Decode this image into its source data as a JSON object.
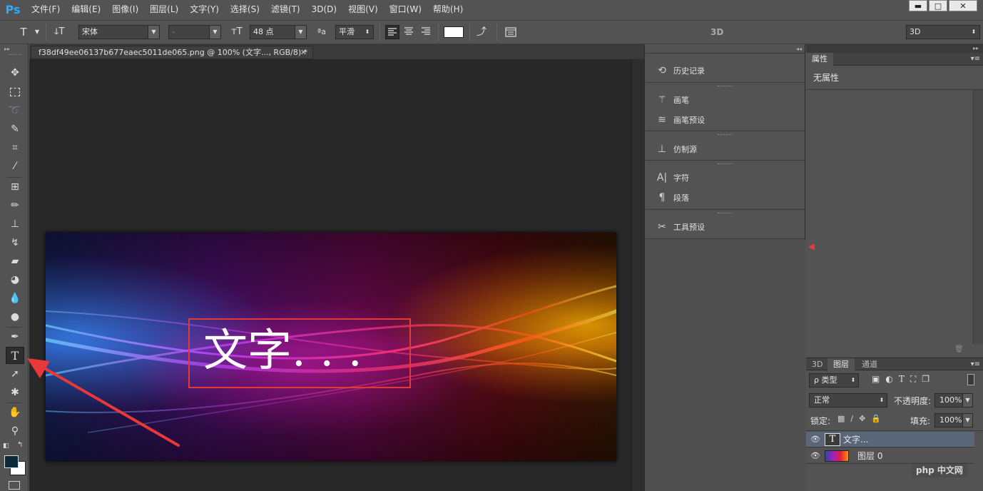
{
  "app": {
    "logo": "Ps"
  },
  "menu": [
    "文件(F)",
    "编辑(E)",
    "图像(I)",
    "图层(L)",
    "文字(Y)",
    "选择(S)",
    "滤镜(T)",
    "3D(D)",
    "视图(V)",
    "窗口(W)",
    "帮助(H)"
  ],
  "window_controls": {
    "minimize": "▬",
    "maximize": "□",
    "close": "✕"
  },
  "options": {
    "tool_icon": "T",
    "orient_icon": "ↆT",
    "font_family": "宋体",
    "font_style": "-",
    "size_icon": "тT",
    "font_size": "48 点",
    "aa_icon": "ªa",
    "antialias": "平滑",
    "workspace_label": "3D",
    "workspace_select": "3D"
  },
  "document": {
    "tab_title": "f38df49ee06137b677eaec5011de065.png @ 100% (文字..., RGB/8) *",
    "canvas_text": "文字. . .",
    "colors": {
      "textbox_border": "#e03a3a",
      "arrow": "#e8383a"
    }
  },
  "mid_panel": {
    "history": "历史记录",
    "brush": "画笔",
    "brush_presets": "画笔预设",
    "clone_source": "仿制源",
    "character": "字符",
    "paragraph": "段落",
    "tool_presets": "工具预设"
  },
  "properties": {
    "tab": "属性",
    "empty_text": "无属性"
  },
  "layers": {
    "tabs": [
      "3D",
      "图层",
      "通道"
    ],
    "filter": "ρ 类型",
    "blend_mode": "正常",
    "opacity_label": "不透明度:",
    "opacity": "100%",
    "lock_label": "锁定:",
    "fill_label": "填充:",
    "fill": "100%",
    "items": [
      {
        "name": "文字...",
        "type": "text"
      },
      {
        "name": "图层 0",
        "type": "image"
      }
    ]
  },
  "watermark": "php 中文网"
}
